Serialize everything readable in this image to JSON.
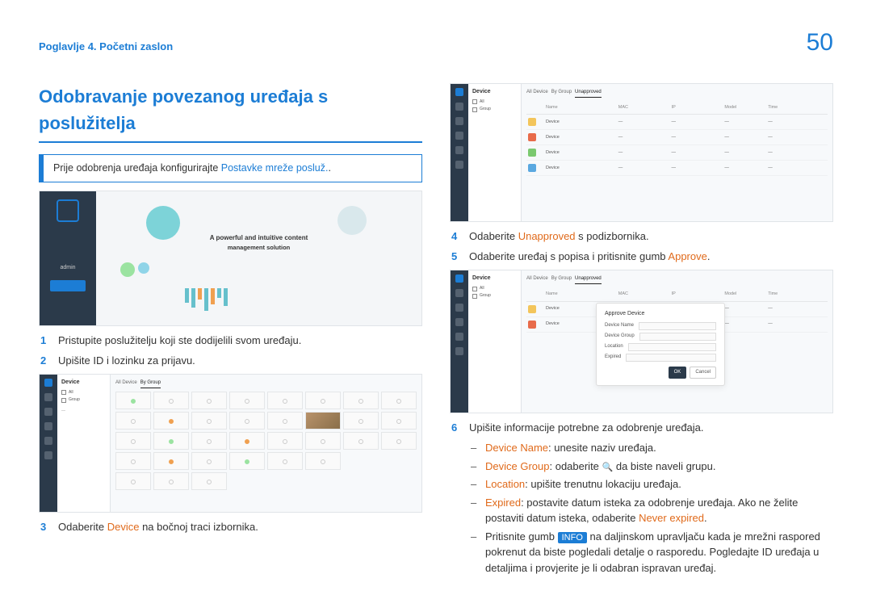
{
  "header": {
    "chapter": "Poglavlje 4. Početni zaslon",
    "page_number": "50"
  },
  "left": {
    "title": "Odobravanje povezanog uređaja s poslužitelja",
    "note_pre": "Prije odobrenja uređaja konfigurirajte ",
    "note_link": "Postavke mreže posluž.",
    "note_post": ".",
    "steps": {
      "s1": "Pristupite poslužitelju koji ste dodijelili svom uređaju.",
      "s2": "Upišite ID i lozinku za prijavu.",
      "s3_a": "Odaberite ",
      "s3_b": "Device",
      "s3_c": " na bočnoj traci izbornika."
    },
    "login_shot": {
      "caption_line1": "A powerful and intuitive content",
      "caption_line2": "management solution",
      "sidebar_label": "admin"
    },
    "grid_shot": {
      "panel_title": "Device",
      "tabs": [
        "All Device",
        "By Group"
      ]
    }
  },
  "right": {
    "table_shot": {
      "panel_title": "Device",
      "tabs": [
        "All Device",
        "By Group",
        "Unapproved"
      ]
    },
    "steps": {
      "s4_a": "Odaberite ",
      "s4_b": "Unapproved",
      "s4_c": " s podizbornika.",
      "s5_a": "Odaberite uređaj s popisa i pritisnite gumb ",
      "s5_b": "Approve",
      "s5_c": ".",
      "s6": "Upišite informacije potrebne za odobrenje uređaja."
    },
    "approve_shot": {
      "modal_title": "Approve Device"
    },
    "subs": {
      "dn_label": "Device Name",
      "dn_text": ": unesite naziv uređaja.",
      "dg_label": "Device Group",
      "dg_text_a": ": odaberite ",
      "dg_text_b": " da biste naveli grupu.",
      "loc_label": "Location",
      "loc_text": ": upišite trenutnu lokaciju uređaja.",
      "exp_label": "Expired",
      "exp_text_a": ": postavite datum isteka za odobrenje uređaja. Ako ne želite postaviti datum isteka, odaberite ",
      "exp_text_b": "Never expired",
      "exp_text_c": ".",
      "info_a": "Pritisnite gumb ",
      "info_badge": "INFO",
      "info_b": " na daljinskom upravljaču kada je mrežni raspored pokrenut da biste pogledali detalje o rasporedu. Pogledajte ID uređaja u detaljima i provjerite je li odabran ispravan uređaj."
    }
  }
}
